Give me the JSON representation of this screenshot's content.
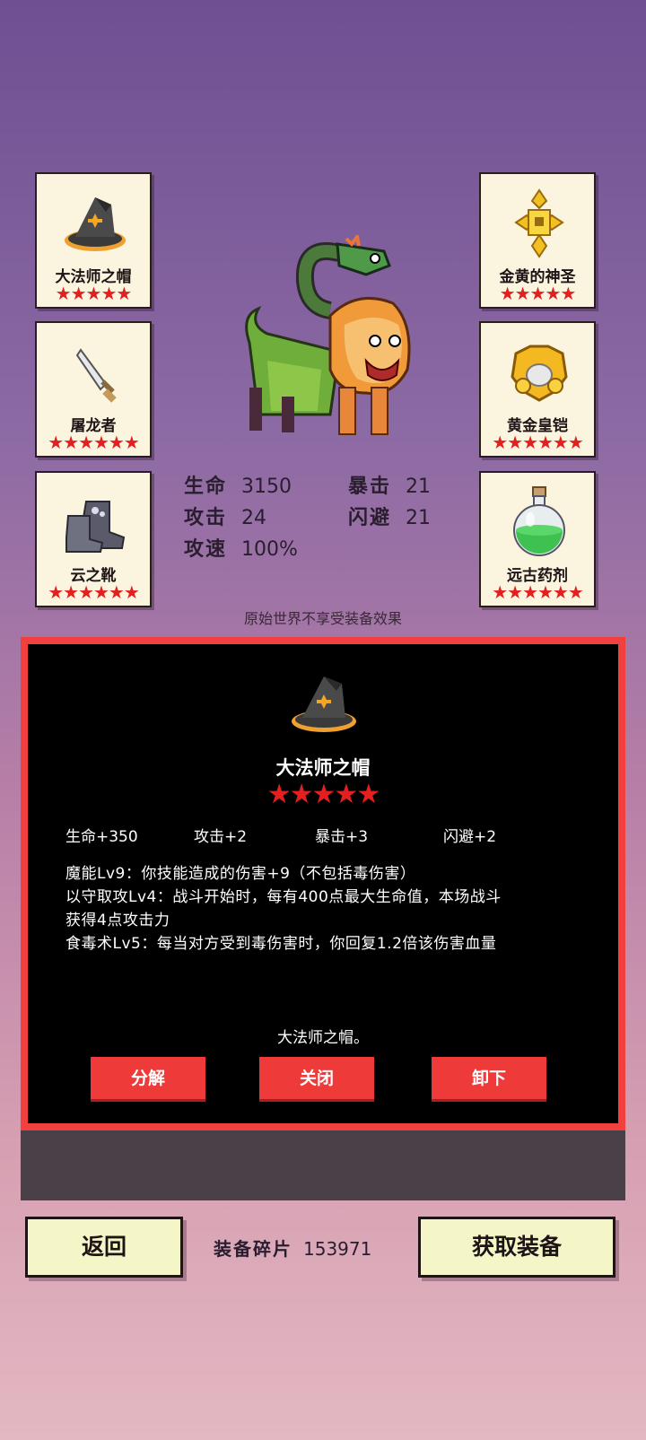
{
  "slots": {
    "left": [
      {
        "name": "大法师之帽",
        "stars": "★★★★★",
        "icon": "wizard-hat-icon"
      },
      {
        "name": "屠龙者",
        "stars": "★★★★★★",
        "icon": "dagger-icon"
      },
      {
        "name": "云之靴",
        "stars": "★★★★★★",
        "icon": "boots-icon"
      }
    ],
    "right": [
      {
        "name": "金黄的神圣",
        "stars": "★★★★★",
        "icon": "gold-cross-icon"
      },
      {
        "name": "黄金皇铠",
        "stars": "★★★★★★",
        "icon": "gold-armor-icon"
      },
      {
        "name": "远古药剂",
        "stars": "★★★★★★",
        "icon": "potion-icon"
      }
    ]
  },
  "stats": {
    "hp_label": "生命",
    "hp": "3150",
    "crit_label": "暴击",
    "crit": "21",
    "atk_label": "攻击",
    "atk": "24",
    "dodge_label": "闪避",
    "dodge": "21",
    "speed_label": "攻速",
    "speed": "100%"
  },
  "note": "原始世界不享受装备效果",
  "detail": {
    "title": "大法师之帽",
    "stars": "★★★★★",
    "icon": "wizard-hat-icon",
    "attrs": [
      "生命+350",
      "攻击+2",
      "暴击+3",
      "闪避+2"
    ],
    "skills": [
      "魔能Lv9：你技能造成的伤害+9（不包括毒伤害）",
      "以守取攻Lv4：战斗开始时，每有400点最大生命值，本场战斗",
      "获得4点攻击力",
      "食毒术Lv5：每当对方受到毒伤害时，你回复1.2倍该伤害血量"
    ],
    "description": "大法师之帽。",
    "buttons": {
      "decompose": "分解",
      "close": "关闭",
      "unequip": "卸下"
    }
  },
  "footer": {
    "back": "返回",
    "shards_label": "装备碎片",
    "shards_value": "153971",
    "get_equipment": "获取装备"
  },
  "colors": {
    "accent_red": "#ee3a38",
    "star_red": "#e3201f",
    "card_bg": "#fbf5df",
    "button_bg": "#f5f6c8"
  }
}
